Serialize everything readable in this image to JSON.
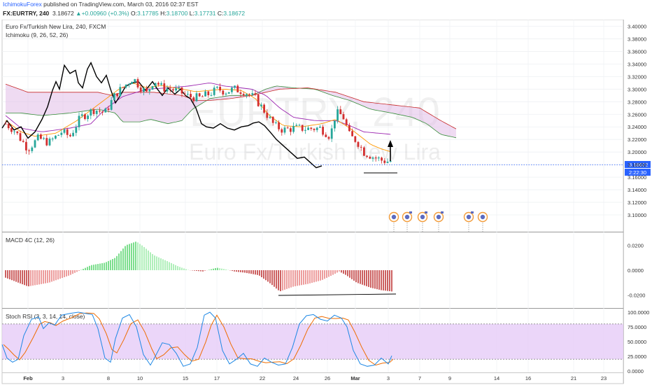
{
  "header": {
    "author": "IchimokuForex",
    "published": "published on TradingView.com, March 03, 2016 02:37 EST",
    "symbol": "FX:EURTRY, 240",
    "last": "3.18672",
    "change": "+0.00960 (+0.3%)",
    "open_label": "O:",
    "open": "3.17785",
    "high_label": "H:",
    "high": "3.18700",
    "low_label": "L:",
    "low": "3.17731",
    "close_label": "C:",
    "close": "3.18672"
  },
  "panes": {
    "main": {
      "title": "Euro Fx/Turkish New Lira, 240, FXCM",
      "indicator": "Ichimoku (9, 26, 52, 26)",
      "watermark_symbol": "EURTRY, 240",
      "watermark_name": "Euro Fx/Turkish New Lira",
      "price_tag": "3.18672",
      "countdown": "2:22:30"
    },
    "macd": {
      "title": "MACD 4C (12, 26)"
    },
    "stoch": {
      "title": "Stoch RSI (3, 3, 14, 14, close)"
    }
  },
  "colors": {
    "up": "#26a69a",
    "down": "#d32f2f",
    "cloud": "#e1bee7",
    "lagging": "#000000",
    "kijun": "#9c27b0",
    "tenkan": "#ff9800",
    "stoch_band": "#e6ccf7",
    "macd_green": "#43d05c",
    "macd_red": "#b71c1c"
  },
  "chart_data": [
    {
      "type": "candlestick",
      "title": "Euro Fx/Turkish New Lira, 240, FXCM",
      "x_ticks": [
        "Feb",
        "3",
        "8",
        "10",
        "15",
        "17",
        "22",
        "24",
        "26",
        "Mar",
        "3",
        "7",
        "9",
        "14",
        "16",
        "21",
        "23"
      ],
      "y_ticks": [
        "3.40000",
        "3.38000",
        "3.36000",
        "3.34000",
        "3.32000",
        "3.30000",
        "3.28000",
        "3.26000",
        "3.24000",
        "3.22000",
        "3.20000",
        "3.18000",
        "3.16000",
        "3.14000",
        "3.12000",
        "3.10000"
      ],
      "ylim": [
        3.09,
        3.405
      ],
      "last_price": 3.18672
    },
    {
      "type": "bar",
      "title": "MACD 4C (12, 26)",
      "y_ticks": [
        "0.0200",
        "0.0000",
        "-0.0200"
      ],
      "ylim": [
        -0.028,
        0.028
      ]
    },
    {
      "type": "line",
      "title": "Stoch RSI (3, 3, 14, 14, close)",
      "y_ticks": [
        "100.0000",
        "75.0000",
        "50.0000",
        "25.0000",
        "0.0000"
      ],
      "ylim": [
        0,
        100
      ],
      "band": [
        20,
        80
      ]
    }
  ]
}
